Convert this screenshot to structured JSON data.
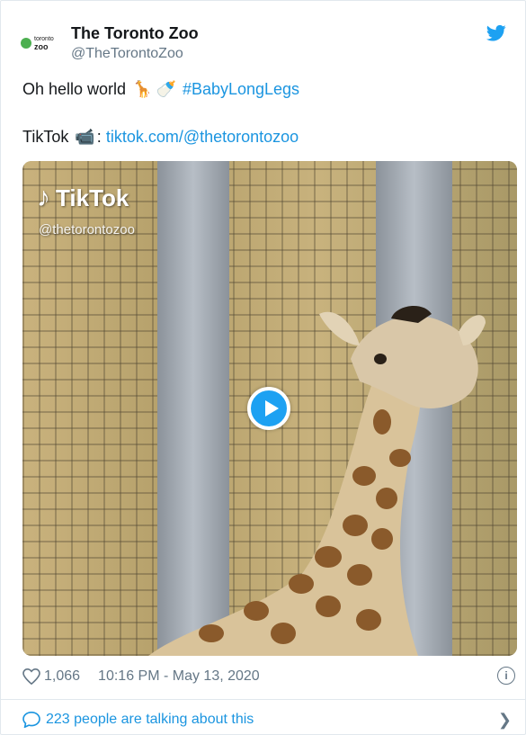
{
  "author": {
    "name": "The Toronto Zoo",
    "handle": "@TheTorontoZoo",
    "logo_line1": "toronto",
    "logo_line2": "zoo"
  },
  "tweet": {
    "line1_text": "Oh hello world",
    "line1_emojis": [
      "giraffe-emoji",
      "baby-bottle-emoji"
    ],
    "hashtag": "#BabyLongLegs",
    "line2_prefix": "TikTok",
    "line2_emoji": "video-camera-emoji",
    "line2_colon": ":",
    "link": "tiktok.com/@thetorontozoo"
  },
  "media": {
    "brand": "TikTok",
    "username": "@thetorontozoo",
    "icon": "play-icon"
  },
  "footer": {
    "likes": "1,066",
    "timestamp": "10:16 PM - May 13, 2020",
    "talking": "223 people are talking about this"
  },
  "colors": {
    "link": "#1b95e0",
    "muted": "#657786",
    "brand_blue": "#1da1f2"
  }
}
